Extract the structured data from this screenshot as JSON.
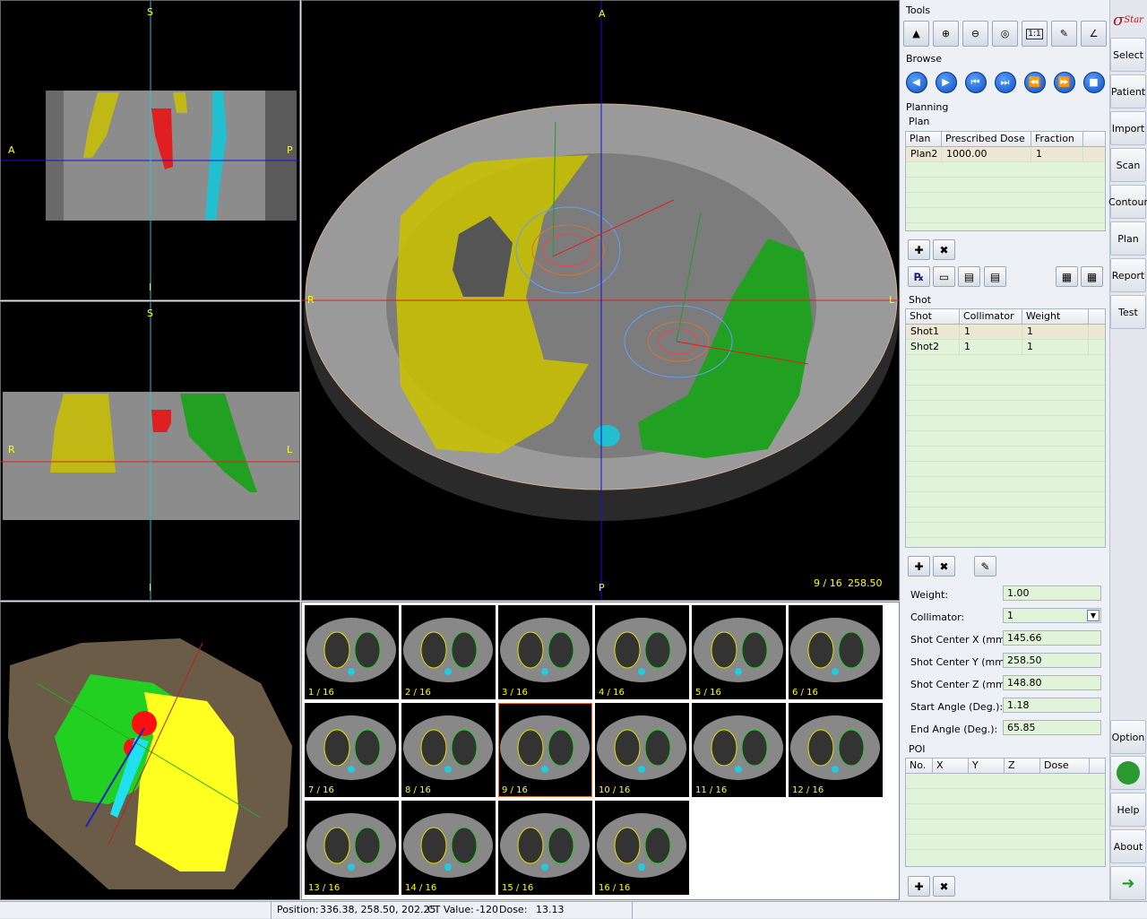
{
  "views": {
    "sagittal": {
      "top": "S",
      "bottom": "I",
      "left": "A",
      "right": "P"
    },
    "coronal": {
      "top": "S",
      "bottom": "I",
      "left": "R",
      "right": "L"
    },
    "axial": {
      "top": "A",
      "bottom": "P",
      "left": "R",
      "right": "L",
      "slice": "9 / 16",
      "coord": "258.50"
    }
  },
  "thumbnails": [
    "1 / 16",
    "2 / 16",
    "3 / 16",
    "4 / 16",
    "5 / 16",
    "6 / 16",
    "7 / 16",
    "8 / 16",
    "9 / 16",
    "10 / 16",
    "11 / 16",
    "12 / 16",
    "13 / 16",
    "14 / 16",
    "15 / 16",
    "16 / 16"
  ],
  "tools": {
    "title": "Tools",
    "browse": "Browse",
    "planning": "Planning",
    "one_to_one": "1:1"
  },
  "plan": {
    "section": "Plan",
    "columns": [
      "Plan",
      "Prescribed Dose",
      "Fraction"
    ],
    "rows": [
      [
        "Plan2",
        "1000.00",
        "1"
      ]
    ]
  },
  "shot": {
    "section": "Shot",
    "columns": [
      "Shot",
      "Collimator",
      "Weight"
    ],
    "rows": [
      [
        "Shot1",
        "1",
        "1"
      ],
      [
        "Shot2",
        "1",
        "1"
      ]
    ]
  },
  "form": {
    "weight_label": "Weight:",
    "weight": "1.00",
    "collimator_label": "Collimator:",
    "collimator": "1",
    "cx_label": "Shot Center X (mm):",
    "cx": "145.66",
    "cy_label": "Shot Center Y (mm):",
    "cy": "258.50",
    "cz_label": "Shot Center Z (mm):",
    "cz": "148.80",
    "start_label": "Start Angle (Deg.):",
    "start": "1.18",
    "end_label": "End Angle (Deg.):",
    "end": "65.85"
  },
  "poi": {
    "section": "POI",
    "columns": [
      "No.",
      "X",
      "Y",
      "Z",
      "Dose"
    ]
  },
  "sidebar": {
    "logo": "Star",
    "items": [
      "Select",
      "Patient",
      "Import",
      "Scan",
      "Contour",
      "Plan",
      "Report",
      "Test"
    ],
    "option": "Option",
    "help": "Help",
    "about": "About"
  },
  "status": {
    "position_label": "Position:",
    "position": "336.38, 258.50, 202.25",
    "ct_label": "CT Value:",
    "ct": "-120",
    "dose_label": "Dose:",
    "dose": "13.13"
  },
  "colors": {
    "left_lung": "#c8c000",
    "right_lung": "#22a022",
    "target": "#e02020",
    "spine": "#20c0d0",
    "accent": "#e07030"
  }
}
